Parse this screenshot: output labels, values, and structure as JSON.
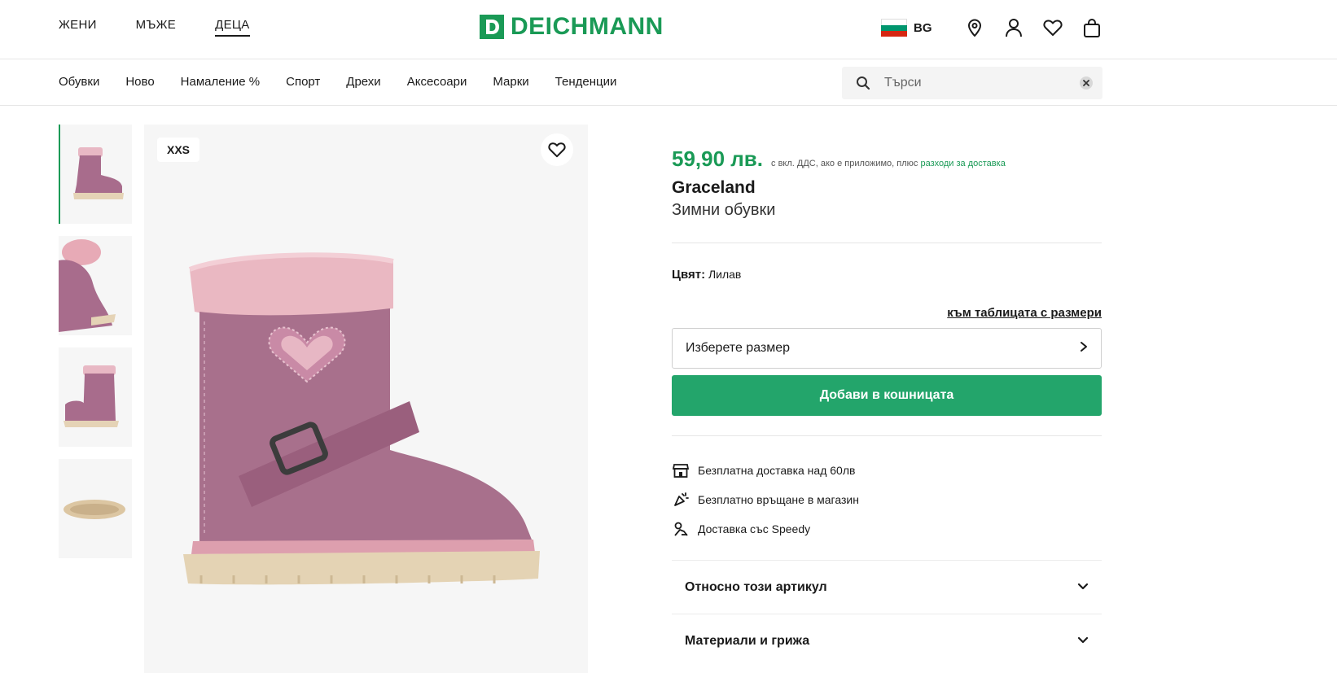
{
  "header": {
    "gender_nav": [
      "ЖЕНИ",
      "МЪЖЕ",
      "ДЕЦА"
    ],
    "active_gender": "ДЕЦА",
    "logo_letter": "D",
    "logo_text": "DEICHMANN",
    "country_code": "BG",
    "flag_colors": [
      "#ffffff",
      "#00966e",
      "#d62612"
    ],
    "icons": [
      "location-icon",
      "account-icon",
      "wishlist-icon",
      "bag-icon"
    ]
  },
  "categories": [
    "Обувки",
    "Ново",
    "Намаление %",
    "Спорт",
    "Дрехи",
    "Аксесоари",
    "Марки",
    "Тенденции"
  ],
  "search": {
    "placeholder": "Търси"
  },
  "gallery": {
    "size_badge": "XXS",
    "thumbnail_count": 4
  },
  "product": {
    "price": "59,90 лв.",
    "price_note": "с вкл. ДДС, ако е приложимо, плюс",
    "shipping_link": "разходи за доставка",
    "brand": "Graceland",
    "name": "Зимни обувки",
    "color_label": "Цвят:",
    "color_value": "Лилав",
    "size_table_link": "към таблицата с размери",
    "size_select_label": "Изберете размер",
    "add_to_cart": "Добави в кошницата"
  },
  "perks": [
    {
      "icon": "store-icon",
      "text": "Безплатна доставка над 60лв"
    },
    {
      "icon": "return-icon",
      "text": "Безплатно връщане в магазин"
    },
    {
      "icon": "delivery-icon",
      "text": "Доставка със Speedy"
    }
  ],
  "accordions": [
    {
      "title": "Относно този артикул"
    },
    {
      "title": "Материали и грижа"
    }
  ],
  "colors": {
    "accent": "#1a9a56",
    "button": "#23a56b"
  }
}
